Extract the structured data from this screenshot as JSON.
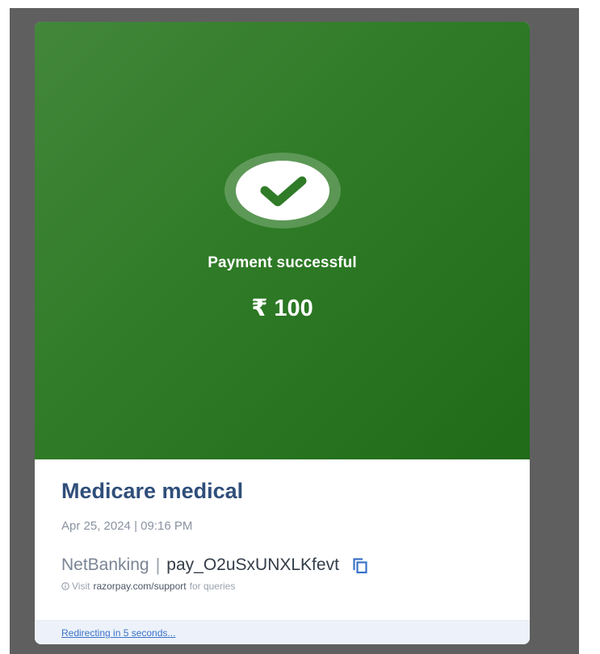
{
  "payment": {
    "status_text": "Payment successful",
    "amount": "₹ 100",
    "merchant_name": "Medicare medical",
    "datetime": "Apr 25, 2024 | 09:16 PM",
    "method": "NetBanking",
    "separator": "|",
    "payment_id": "pay_O2uSxUNXLKfevt"
  },
  "support": {
    "prefix": "Visit",
    "link": "razorpay.com/support",
    "suffix": "for queries"
  },
  "footer": {
    "redirect_text": "Redirecting in 5 seconds..."
  },
  "icons": {
    "status": "check-circle-icon",
    "copy": "copy-icon",
    "info": "info-icon"
  },
  "colors": {
    "hero_green": "#2f7b27",
    "merchant_text": "#2f4e7a",
    "link_blue": "#3a72c8",
    "overlay_gray": "#5f5f5f"
  }
}
